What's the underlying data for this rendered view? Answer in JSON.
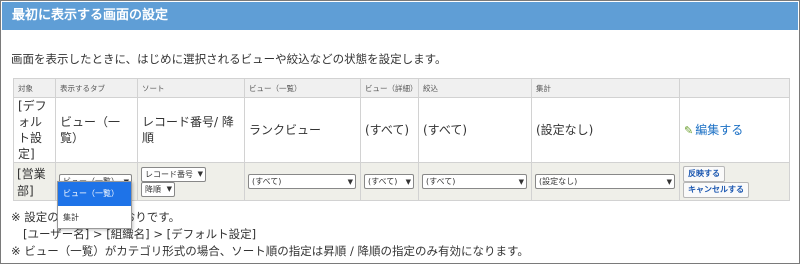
{
  "header": {
    "title": "最初に表示する画面の設定"
  },
  "description": "画面を表示したときに、はじめに選択されるビューや絞込などの状態を設定します。",
  "table": {
    "columns": [
      "対象",
      "表示するタブ",
      "ソート",
      "ビュー（一覧）",
      "ビュー（詳細）",
      "絞込",
      "集計",
      ""
    ],
    "default_row": {
      "target": "[デフォルト設定]",
      "tab": "ビュー（一覧）",
      "sort": "レコード番号/ 降順",
      "view_list": "ランクビュー",
      "view_detail": "(すべて)",
      "filter": "(すべて)",
      "aggregate": "(設定なし)",
      "edit_label": "編集する"
    },
    "edit_row": {
      "target": "[営業部]",
      "tab_select": "ビュー（一覧）",
      "sort_field_select": "レコード番号",
      "sort_order_select": "降順",
      "view_list_select": "(すべて)",
      "view_detail_select": "(すべて)",
      "filter_select": "(すべて)",
      "aggregate_select": "(設定なし)",
      "apply_button": "反映する",
      "cancel_button": "キャンセルする"
    }
  },
  "dropdown": {
    "options": [
      "ビュー（一覧）",
      "集計"
    ],
    "selected_index": 0
  },
  "notes": {
    "line1_start": "※ 設定の",
    "line1_end": "のとおりです。",
    "line2": "[ユーザー名] > [組織名] > [デフォルト設定]",
    "line3": "※ ビュー（一覧）がカテゴリ形式の場合、ソート順の指定は昇順 / 降順の指定のみ有効になります。"
  },
  "icons": {
    "edit": "pencil-icon",
    "select_arrow": "chevron-down-icon"
  },
  "colors": {
    "title_bar": "#5f9ed6",
    "link": "#1a6fc4",
    "dropdown_selected": "#1e73e8",
    "edit_row_bg": "#efefe9"
  }
}
